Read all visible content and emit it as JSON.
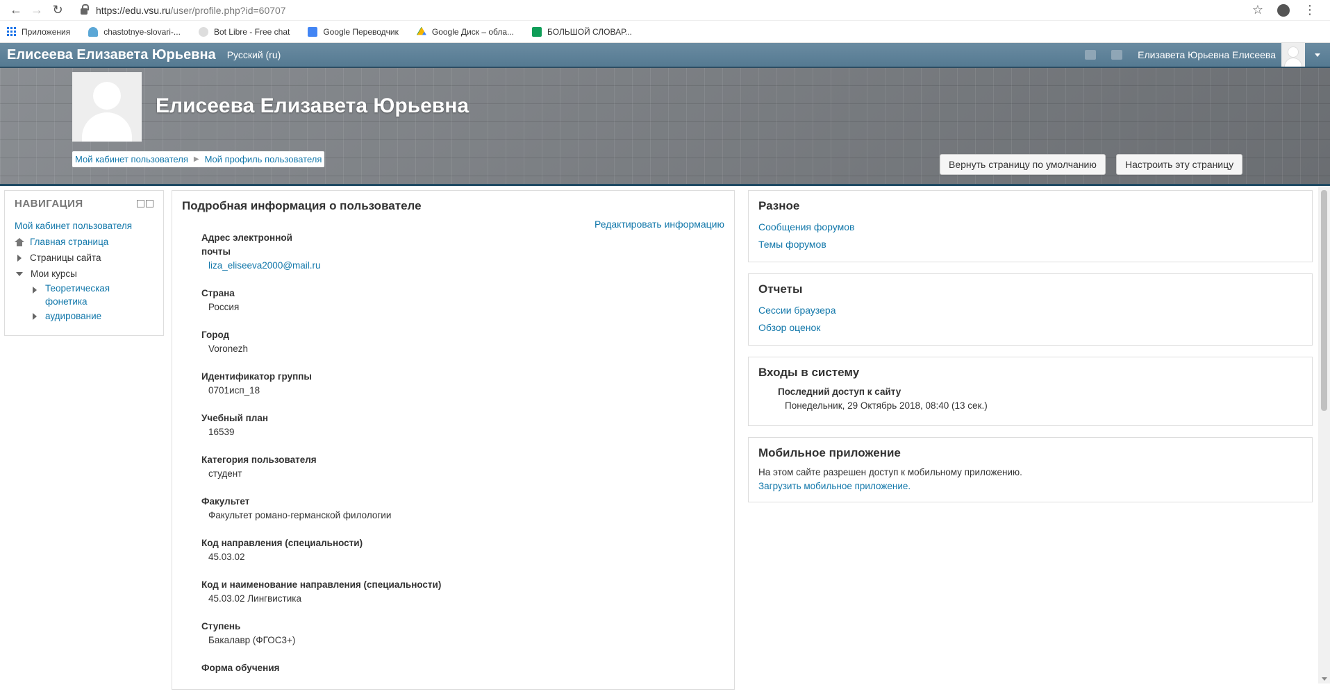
{
  "browser": {
    "url_host": "https://edu.vsu.ru",
    "url_path": "/user/profile.php?id=60707",
    "bookmarks": [
      {
        "label": "Приложения",
        "icon": "apps-icon"
      },
      {
        "label": "chastotnye-slovari-...",
        "icon": "folder-icon"
      },
      {
        "label": "Bot Libre - Free chat",
        "icon": "bot-icon"
      },
      {
        "label": "Google Переводчик",
        "icon": "translate-icon"
      },
      {
        "label": "Google Диск – обла...",
        "icon": "drive-icon"
      },
      {
        "label": "БОЛЬШОЙ СЛОВАР...",
        "icon": "sheets-icon"
      }
    ]
  },
  "navbar": {
    "brand": "Елисеева Елизавета Юрьевна",
    "language": "Русский (ru)",
    "user_name": "Елизавета Юрьевна Елисеева"
  },
  "header": {
    "name": "Елисеева Елизавета Юрьевна",
    "breadcrumb": [
      "Мой кабинет пользователя",
      "Мой профиль пользователя"
    ],
    "reset_button": "Вернуть страницу по умолчанию",
    "customize_button": "Настроить эту страницу"
  },
  "navigation": {
    "title": "НАВИГАЦИЯ",
    "dashboard": "Мой кабинет пользователя",
    "home": "Главная страница",
    "site_pages": "Страницы сайта",
    "my_courses": "Мои курсы",
    "courses": [
      "Теоретическая фонетика",
      "аудирование"
    ]
  },
  "details": {
    "title": "Подробная информация о пользователе",
    "edit_link": "Редактировать информацию",
    "fields": [
      {
        "label": "Адрес электронной почты",
        "value": "liza_eliseeva2000@mail.ru",
        "link": true
      },
      {
        "label": "Страна",
        "value": "Россия"
      },
      {
        "label": "Город",
        "value": "Voronezh"
      },
      {
        "label": "Идентификатор группы",
        "value": "0701исп_18"
      },
      {
        "label": "Учебный план",
        "value": "16539"
      },
      {
        "label": "Категория пользователя",
        "value": "студент"
      },
      {
        "label": "Факультет",
        "value": "Факультет романо-германской филологии"
      },
      {
        "label": "Код направления (специальности)",
        "value": "45.03.02"
      },
      {
        "label": "Код и наименование направления (специальности)",
        "value": "45.03.02 Лингвистика"
      },
      {
        "label": "Ступень",
        "value": "Бакалавр (ФГОС3+)"
      },
      {
        "label": "Форма обучения",
        "value": ""
      }
    ]
  },
  "misc": {
    "title": "Разное",
    "links": [
      "Сообщения форумов",
      "Темы форумов"
    ]
  },
  "reports": {
    "title": "Отчеты",
    "links": [
      "Сессии браузера",
      "Обзор оценок"
    ]
  },
  "logins": {
    "title": "Входы в систему",
    "last_access_label": "Последний доступ к сайту",
    "last_access_value": "Понедельник, 29 Октябрь 2018, 08:40  (13 сек.)"
  },
  "mobile": {
    "title": "Мобильное приложение",
    "text": "На этом сайте разрешен доступ к мобильному приложению.",
    "link": "Загрузить мобильное приложение."
  },
  "colors": {
    "navbar": "#5c7f96",
    "link": "#1177aa",
    "banner_border": "#1f4a63"
  }
}
